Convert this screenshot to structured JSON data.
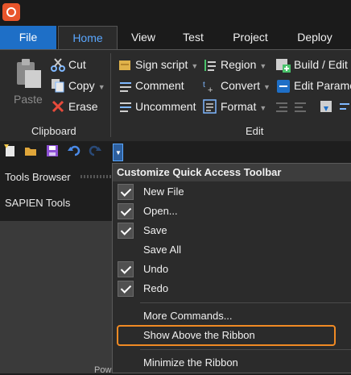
{
  "tabs": [
    "File",
    "Home",
    "View",
    "Test",
    "Project",
    "Deploy"
  ],
  "ribbon": {
    "clipboard": {
      "paste": "Paste",
      "cut": "Cut",
      "copy": "Copy",
      "erase": "Erase",
      "label": "Clipboard"
    },
    "edit": {
      "sign_script": "Sign script",
      "comment": "Comment",
      "uncomment": "Uncomment",
      "region": "Region",
      "convert": "Convert",
      "format": "Format",
      "build_edit": "Build / Edit",
      "edit_params": "Edit Parame",
      "label": "Edit"
    }
  },
  "left_panel": {
    "title": "Tools Browser",
    "section": "SAPIEN Tools",
    "footer_text": "Pow"
  },
  "menu": {
    "title": "Customize Quick Access Toolbar",
    "items": [
      {
        "label": "New File",
        "checked": true
      },
      {
        "label": "Open...",
        "checked": true
      },
      {
        "label": "Save",
        "checked": true
      },
      {
        "label": "Save All",
        "checked": false
      },
      {
        "label": "Undo",
        "checked": true
      },
      {
        "label": "Redo",
        "checked": true
      }
    ],
    "more_commands": "More Commands...",
    "show_above": "Show Above the Ribbon",
    "minimize": "Minimize the Ribbon"
  },
  "colors": {
    "accent_blue": "#1e6fc7",
    "highlight_orange": "#f08a24",
    "app_logo": "#e8552b"
  }
}
